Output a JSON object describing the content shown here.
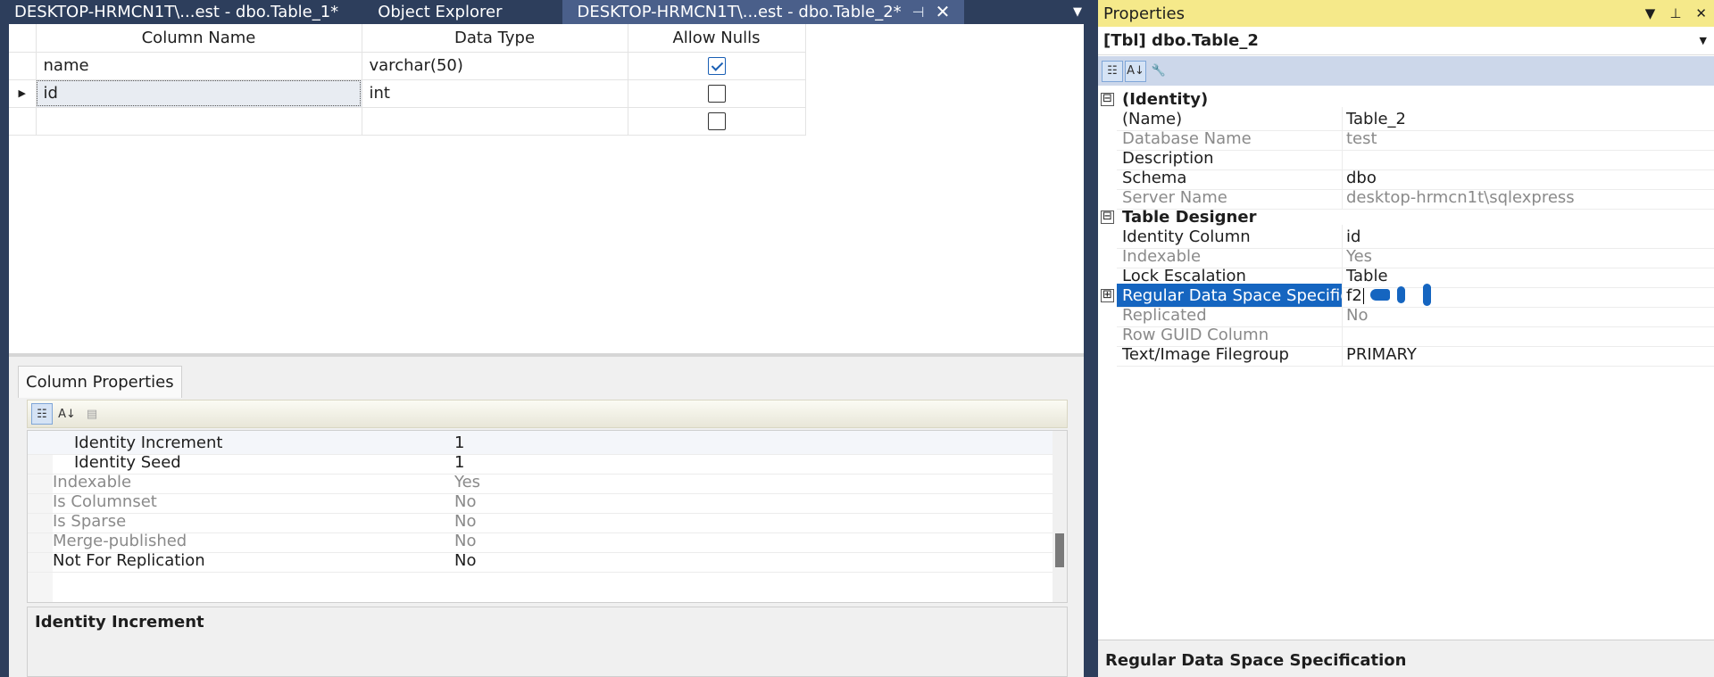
{
  "tabs": [
    {
      "label": "DESKTOP-HRMCN1T\\...est - dbo.Table_1*",
      "active": false
    },
    {
      "label": "Object Explorer",
      "active": false
    },
    {
      "label": "DESKTOP-HRMCN1T\\...est - dbo.Table_2*",
      "active": true
    }
  ],
  "designer": {
    "headers": {
      "column_name": "Column Name",
      "data_type": "Data Type",
      "allow_nulls": "Allow Nulls"
    },
    "rows": [
      {
        "name": "name",
        "type": "varchar(50)",
        "nulls": true,
        "current": false
      },
      {
        "name": "id",
        "type": "int",
        "nulls": false,
        "current": true
      },
      {
        "name": "",
        "type": "",
        "nulls": false,
        "current": false
      }
    ]
  },
  "column_properties": {
    "tab_label": "Column Properties",
    "rows": [
      {
        "key": "Identity Increment",
        "value": "1",
        "indent": true,
        "dim": false,
        "selected": true
      },
      {
        "key": "Identity Seed",
        "value": "1",
        "indent": true,
        "dim": false,
        "selected": false
      },
      {
        "key": "Indexable",
        "value": "Yes",
        "indent": false,
        "dim": true,
        "selected": false
      },
      {
        "key": "Is Columnset",
        "value": "No",
        "indent": false,
        "dim": true,
        "selected": false
      },
      {
        "key": "Is Sparse",
        "value": "No",
        "indent": false,
        "dim": true,
        "selected": false
      },
      {
        "key": "Merge-published",
        "value": "No",
        "indent": false,
        "dim": true,
        "selected": false
      },
      {
        "key": "Not For Replication",
        "value": "No",
        "indent": false,
        "dim": false,
        "selected": false
      }
    ],
    "description_title": "Identity Increment"
  },
  "properties": {
    "title": "Properties",
    "object": "[Tbl] dbo.Table_2",
    "rows": [
      {
        "type": "category",
        "label": "(Identity)",
        "expander": "⊟"
      },
      {
        "type": "prop",
        "key": "(Name)",
        "value": "Table_2",
        "dim": false
      },
      {
        "type": "prop",
        "key": "Database Name",
        "value": "test",
        "dim": true
      },
      {
        "type": "prop",
        "key": "Description",
        "value": "",
        "dim": false
      },
      {
        "type": "prop",
        "key": "Schema",
        "value": "dbo",
        "dim": false
      },
      {
        "type": "prop",
        "key": "Server Name",
        "value": "desktop-hrmcn1t\\sqlexpress",
        "dim": true
      },
      {
        "type": "category",
        "label": "Table Designer",
        "expander": "⊟"
      },
      {
        "type": "prop",
        "key": "Identity Column",
        "value": "id",
        "dim": false
      },
      {
        "type": "prop",
        "key": "Indexable",
        "value": "Yes",
        "dim": true
      },
      {
        "type": "prop",
        "key": "Lock Escalation",
        "value": "Table",
        "dim": false
      },
      {
        "type": "prop",
        "key": "Regular Data Space Specification",
        "value": "f2",
        "dim": false,
        "selected": true,
        "expander": "⊞"
      },
      {
        "type": "prop",
        "key": "Replicated",
        "value": "No",
        "dim": true
      },
      {
        "type": "prop",
        "key": "Row GUID Column",
        "value": "",
        "dim": true
      },
      {
        "type": "prop",
        "key": "Text/Image Filegroup",
        "value": "PRIMARY",
        "dim": false
      }
    ],
    "description_title": "Regular Data Space Specification"
  },
  "colors": {
    "accent": "#1565c0",
    "titlebar": "#f5e98a",
    "chrome": "#2d3e5c"
  }
}
